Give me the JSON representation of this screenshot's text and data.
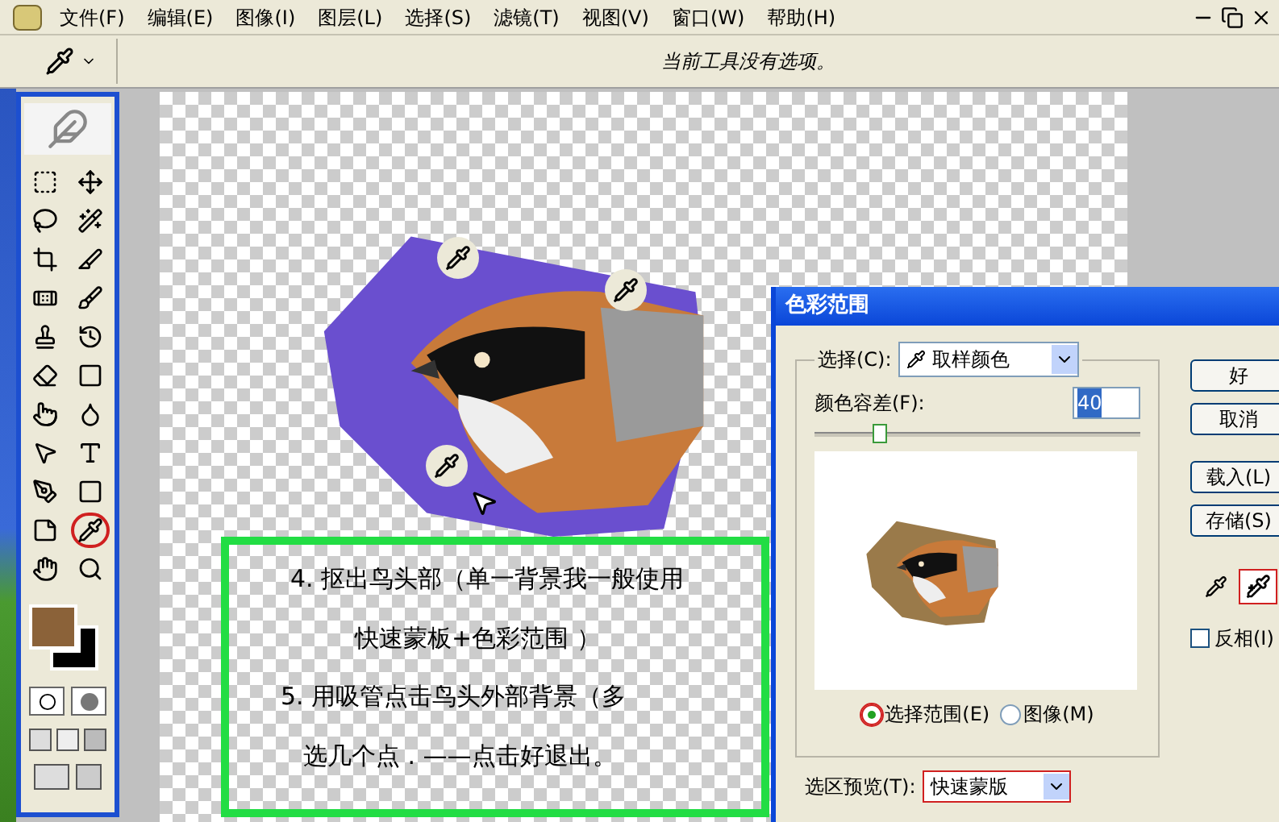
{
  "menu": [
    {
      "label": "文件(F)"
    },
    {
      "label": "编辑(E)"
    },
    {
      "label": "图像(I)"
    },
    {
      "label": "图层(L)"
    },
    {
      "label": "选择(S)"
    },
    {
      "label": "滤镜(T)"
    },
    {
      "label": "视图(V)"
    },
    {
      "label": "窗口(W)"
    },
    {
      "label": "帮助(H)"
    }
  ],
  "options_bar": {
    "message": "当前工具没有选项。"
  },
  "toolbox": {
    "tools": [
      {
        "kind": "marquee",
        "selected": false
      },
      {
        "kind": "move",
        "selected": false
      },
      {
        "kind": "lasso",
        "selected": false
      },
      {
        "kind": "wand",
        "selected": false
      },
      {
        "kind": "crop",
        "selected": false
      },
      {
        "kind": "slice",
        "selected": false
      },
      {
        "kind": "healing",
        "selected": false
      },
      {
        "kind": "brush",
        "selected": false
      },
      {
        "kind": "stamp",
        "selected": false
      },
      {
        "kind": "history",
        "selected": false
      },
      {
        "kind": "eraser",
        "selected": false
      },
      {
        "kind": "gradient",
        "selected": false
      },
      {
        "kind": "smudge",
        "selected": false
      },
      {
        "kind": "dodge",
        "selected": false
      },
      {
        "kind": "pointer",
        "selected": false
      },
      {
        "kind": "type",
        "selected": false
      },
      {
        "kind": "pen",
        "selected": false
      },
      {
        "kind": "shape",
        "selected": false
      },
      {
        "kind": "notes",
        "selected": false
      },
      {
        "kind": "eyedropper",
        "selected": true
      },
      {
        "kind": "hand",
        "selected": false
      },
      {
        "kind": "zoom",
        "selected": false
      }
    ],
    "swatches": [
      {
        "kind": "foreground",
        "color": "#8b6239"
      },
      {
        "kind": "background",
        "color": "#000000"
      }
    ]
  },
  "canvas": {
    "annotation": [
      "4. 抠出鸟头部（单一背景我一般使用",
      "快速蒙板+色彩范围 ）",
      "5. 用吸管点击鸟头外部背景（多",
      "选几个点 . ——点击好退出。"
    ]
  },
  "dialog": {
    "title": "色彩范围",
    "select_label": "选择(C):",
    "select_value": "取样颜色",
    "fuzziness_label": "颜色容差(F):",
    "fuzziness_value": "40",
    "fuzziness_slider": {
      "level": 0.2
    },
    "buttons": [
      {
        "label": "好"
      },
      {
        "label": "取消"
      },
      {
        "label": "载入(L)"
      },
      {
        "label": "存储(S)"
      }
    ],
    "eyedroppers": [
      {
        "kind": "plain",
        "selected": false
      },
      {
        "kind": "add",
        "selected": true
      }
    ],
    "invert": {
      "label": "反相(I)",
      "checked": false
    },
    "radios": [
      {
        "label": "选择范围(E)",
        "selected": true
      },
      {
        "label": "图像(M)",
        "selected": false
      }
    ],
    "preview_label": "选区预览(T):",
    "preview_value": "快速蒙版"
  }
}
